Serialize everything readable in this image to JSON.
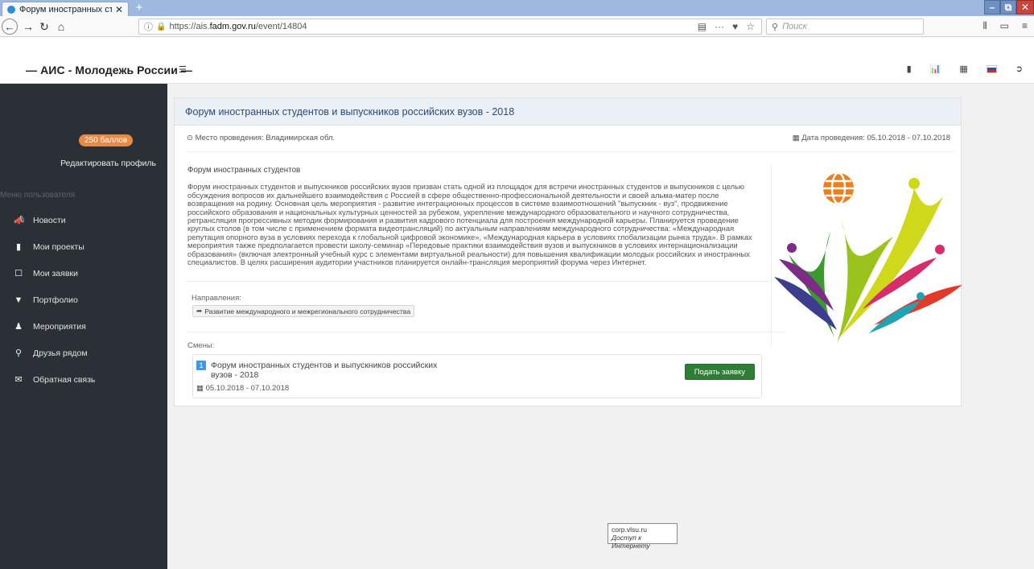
{
  "browser": {
    "tab_title": "Форум иностранных студенте",
    "tab_close": "✕",
    "new_tab": "+",
    "url_prefix": "https://ais.",
    "url_domain": "fadm.gov.ru",
    "url_path": "/event/14804",
    "search_placeholder": "Поиск",
    "icons": [
      "back-arrow",
      "forward-arrow",
      "reload",
      "home",
      "info",
      "lock",
      "reader",
      "more",
      "pocket",
      "bookmark-star",
      "search",
      "library",
      "sidebar",
      "menu"
    ]
  },
  "site": {
    "brand": "— АИС - Молодежь России —",
    "header_icons": [
      "book-icon",
      "chart-icon",
      "table-icon",
      "flag-ru-icon",
      "logout-icon"
    ]
  },
  "sidebar": {
    "points_badge": "250 баллов",
    "edit_profile": "Редактировать профиль",
    "menu_title": "Меню пользователя",
    "items": [
      {
        "label": "Новости",
        "icon": "megaphone-icon"
      },
      {
        "label": "Мои проекты",
        "icon": "book-icon"
      },
      {
        "label": "Мои заявки",
        "icon": "bookmark-icon"
      },
      {
        "label": "Портфолио",
        "icon": "folder-icon"
      },
      {
        "label": "Мероприятия",
        "icon": "people-icon"
      },
      {
        "label": "Друзья рядом",
        "icon": "map-marker-icon"
      },
      {
        "label": "Обратная связь",
        "icon": "envelope-icon"
      }
    ]
  },
  "event": {
    "title": "Форум иностранных студентов и выпускников российских вузов - 2018",
    "place_label": "Место проведения: Владимирская обл.",
    "date_label": "Дата проведения: 05.10.2018 - 07.10.2018",
    "desc_title": "Форум иностранных студентов",
    "description": "Форум иностранных студентов и выпускников российских вузов призван стать одной из площадок для встречи иностранных студентов и выпускников с целью обсуждения вопросов их дальнейшего взаимодействия с Россией в сфере общественно-профессиональной деятельности и своей альма-матер после возвращения на родину. Основная цель мероприятия - развитие интеграционных процессов в системе взаимоотношений \"выпускник - вуз\", продвижение российского образования и национальных культурных ценностей за рубежом, укрепление международного образовательного и научного сотрудничества, ретрансляция прогрессивных методик формирования и развития кадрового потенциала для построения международной карьеры. Планируется проведение круглых столов (в том числе с применением формата видеотрансляций) по актуальным направлениям международного сотрудничества: «Международная репутация опорного вуза в условиях перехода к глобальной цифровой экономике», «Международная карьера в условиях глобализации рынка труда». В рамках мероприятия также предполагается провести школу-семинар «Передовые практики взаимодействия вузов и выпускников в условиях интернационализации образования» (включая электронный учебный курс с элементами виртуальной реальности) для повышения квалификации молодых российских и иностранных специалистов. В целях расширения аудитории участников планируется онлайн-трансляция мероприятий форума через Интернет.",
    "directions_label": "Направления:",
    "direction_tag": "Развитие международного и межрегионального сотрудничества",
    "shifts_label": "Смены:",
    "shift": {
      "number": "1",
      "title_line1": "Форум иностранных студентов и выпускников российских",
      "title_line2": "вузов - 2018",
      "dates": "05.10.2018 - 07.10.2018",
      "apply_label": "Подать заявку"
    }
  },
  "tooltip": {
    "line1": "corp.vlsu.ru",
    "line2": "Доступ к Интернету"
  }
}
